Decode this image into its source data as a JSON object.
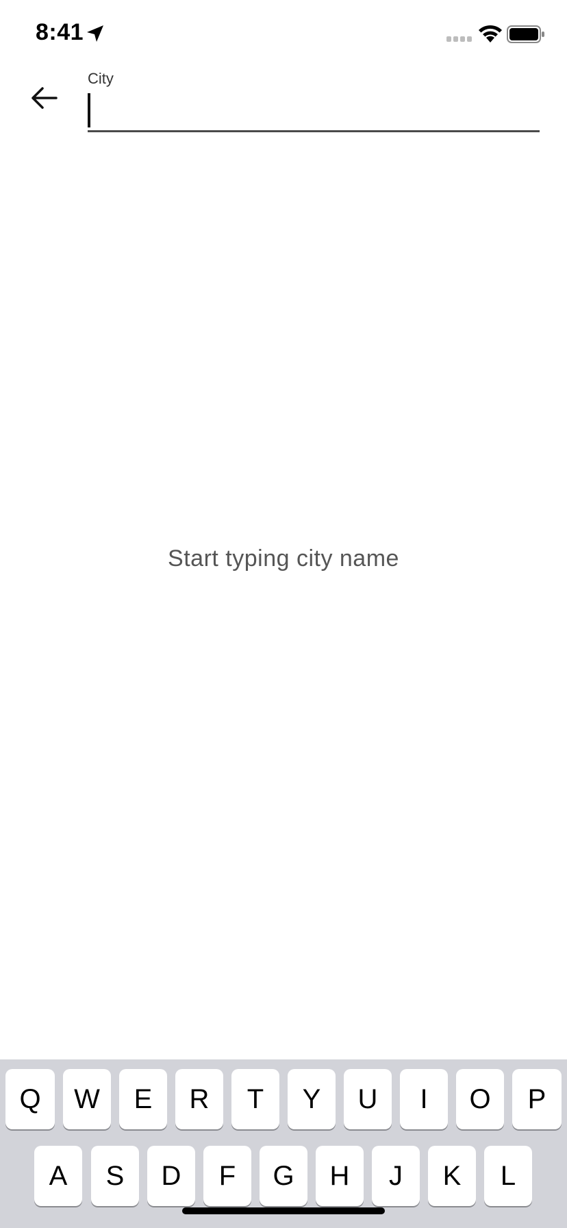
{
  "status_bar": {
    "time": "8:41",
    "icons": {
      "location": "location-arrow-icon",
      "signal": "cellular-signal-icon",
      "wifi": "wifi-icon",
      "battery": "battery-icon"
    }
  },
  "header": {
    "back_icon": "back-arrow-icon",
    "city_field": {
      "label": "City",
      "value": "",
      "placeholder": ""
    }
  },
  "main": {
    "empty_message": "Start typing city name"
  },
  "keyboard": {
    "row1": [
      "Q",
      "W",
      "E",
      "R",
      "T",
      "Y",
      "U",
      "I",
      "O",
      "P"
    ],
    "row2": [
      "A",
      "S",
      "D",
      "F",
      "G",
      "H",
      "J",
      "K",
      "L"
    ]
  },
  "colors": {
    "background": "#ffffff",
    "keyboard_bg": "#d2d3d9",
    "key_bg": "#ffffff",
    "text_primary": "#000000",
    "text_secondary": "#555555",
    "underline": "#4a4a4a"
  }
}
